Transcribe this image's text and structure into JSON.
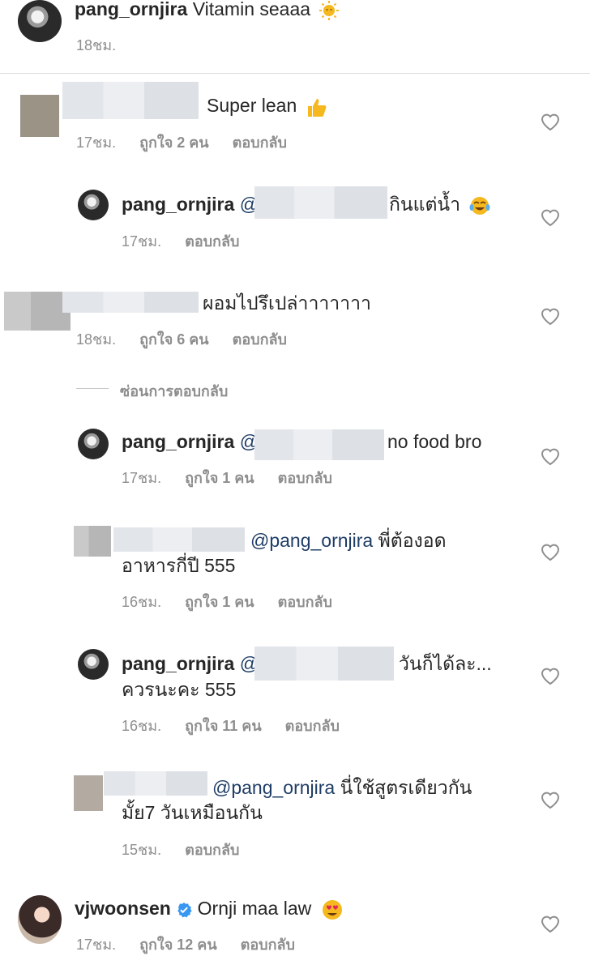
{
  "colors": {
    "text": "#262626",
    "muted": "#8e8e8e",
    "mention": "#1f3d66",
    "verified": "#3897f0"
  },
  "caption": {
    "username": "pang_ornjira",
    "text": "Vitamin seaaa",
    "emoji": "sun-emoji",
    "time": "18ชม."
  },
  "comments": [
    {
      "text": "Super lean",
      "emoji": "thumbs-up-emoji",
      "time": "17ชม.",
      "likes": "ถูกใจ 2 คน",
      "reply": "ตอบกลับ"
    },
    {
      "username": "pang_ornjira",
      "mention_prefix": "@",
      "text": "กินแต่น้ำ",
      "emoji": "tears-of-joy-emoji",
      "time": "17ชม.",
      "reply": "ตอบกลับ"
    },
    {
      "text": "ผอมไปรึเปล่าาาาาาา",
      "time": "18ชม.",
      "likes": "ถูกใจ 6 คน",
      "reply": "ตอบกลับ"
    },
    {
      "username": "pang_ornjira",
      "mention_prefix": "@",
      "text": "no food bro",
      "time": "17ชม.",
      "likes": "ถูกใจ 1 คน",
      "reply": "ตอบกลับ"
    },
    {
      "mention": "@pang_ornjira",
      "text": "พี่ต้องอด",
      "text2": "อาหารกี่ปี 555",
      "time": "16ชม.",
      "likes": "ถูกใจ 1 คน",
      "reply": "ตอบกลับ"
    },
    {
      "username": "pang_ornjira",
      "mention_prefix": "@",
      "text": "วันก็ได้ละ...",
      "text2": "ควรนะคะ 555",
      "time": "16ชม.",
      "likes": "ถูกใจ 11 คน",
      "reply": "ตอบกลับ"
    },
    {
      "mention": "@pang_ornjira",
      "text": "นี่ใช้สูตรเดียวกัน",
      "text2": "มั้ย7 วันเหมือนกัน",
      "time": "15ชม.",
      "reply": "ตอบกลับ"
    },
    {
      "username": "vjwoonsen",
      "text": "Ornji maa law",
      "emoji": "heart-eyes-emoji",
      "time": "17ชม.",
      "likes": "ถูกใจ 12 คน",
      "reply": "ตอบกลับ"
    }
  ],
  "hide_replies": "ซ่อนการตอบกลับ"
}
